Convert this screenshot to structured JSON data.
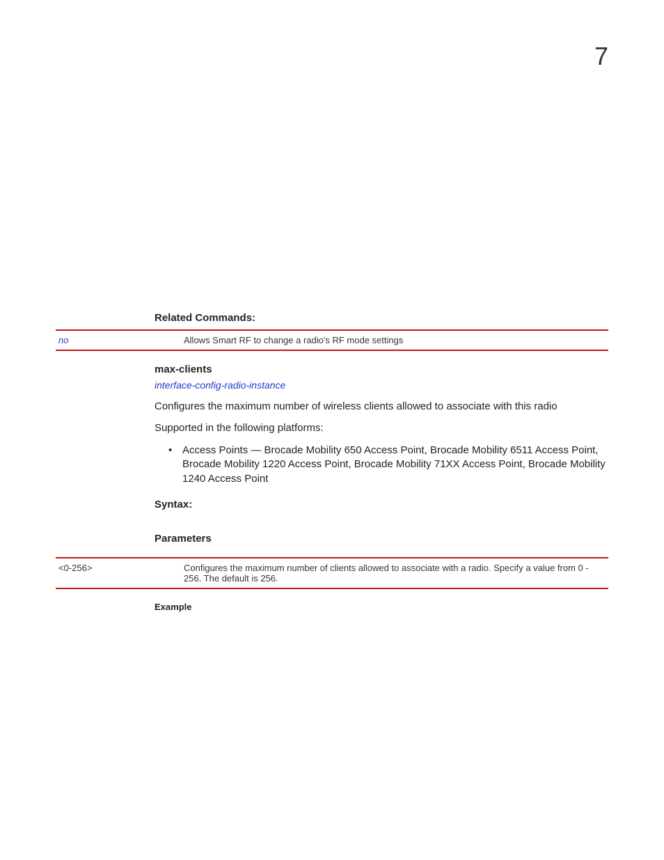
{
  "page_number": "7",
  "related_commands": {
    "heading": "Related Commands:",
    "row": {
      "key": "no",
      "desc": "Allows Smart RF to change a radio's RF mode settings"
    }
  },
  "max_clients": {
    "title": "max-clients",
    "context_link": "interface-config-radio-instance",
    "description": "Configures the maximum number of wireless clients allowed to associate with this radio",
    "supported_intro": "Supported in the following platforms:",
    "supported_bullet": "Access Points — Brocade Mobility 650 Access Point, Brocade Mobility 6511 Access Point, Brocade Mobility 1220 Access Point, Brocade Mobility 71XX Access Point, Brocade Mobility 1240 Access Point",
    "syntax_heading": "Syntax:",
    "parameters_heading": "Parameters",
    "param_row": {
      "key": "<0-256>",
      "desc": "Configures the maximum number of clients allowed to associate with a radio. Specify a value from 0 - 256. The default is 256."
    },
    "example_heading": "Example"
  }
}
